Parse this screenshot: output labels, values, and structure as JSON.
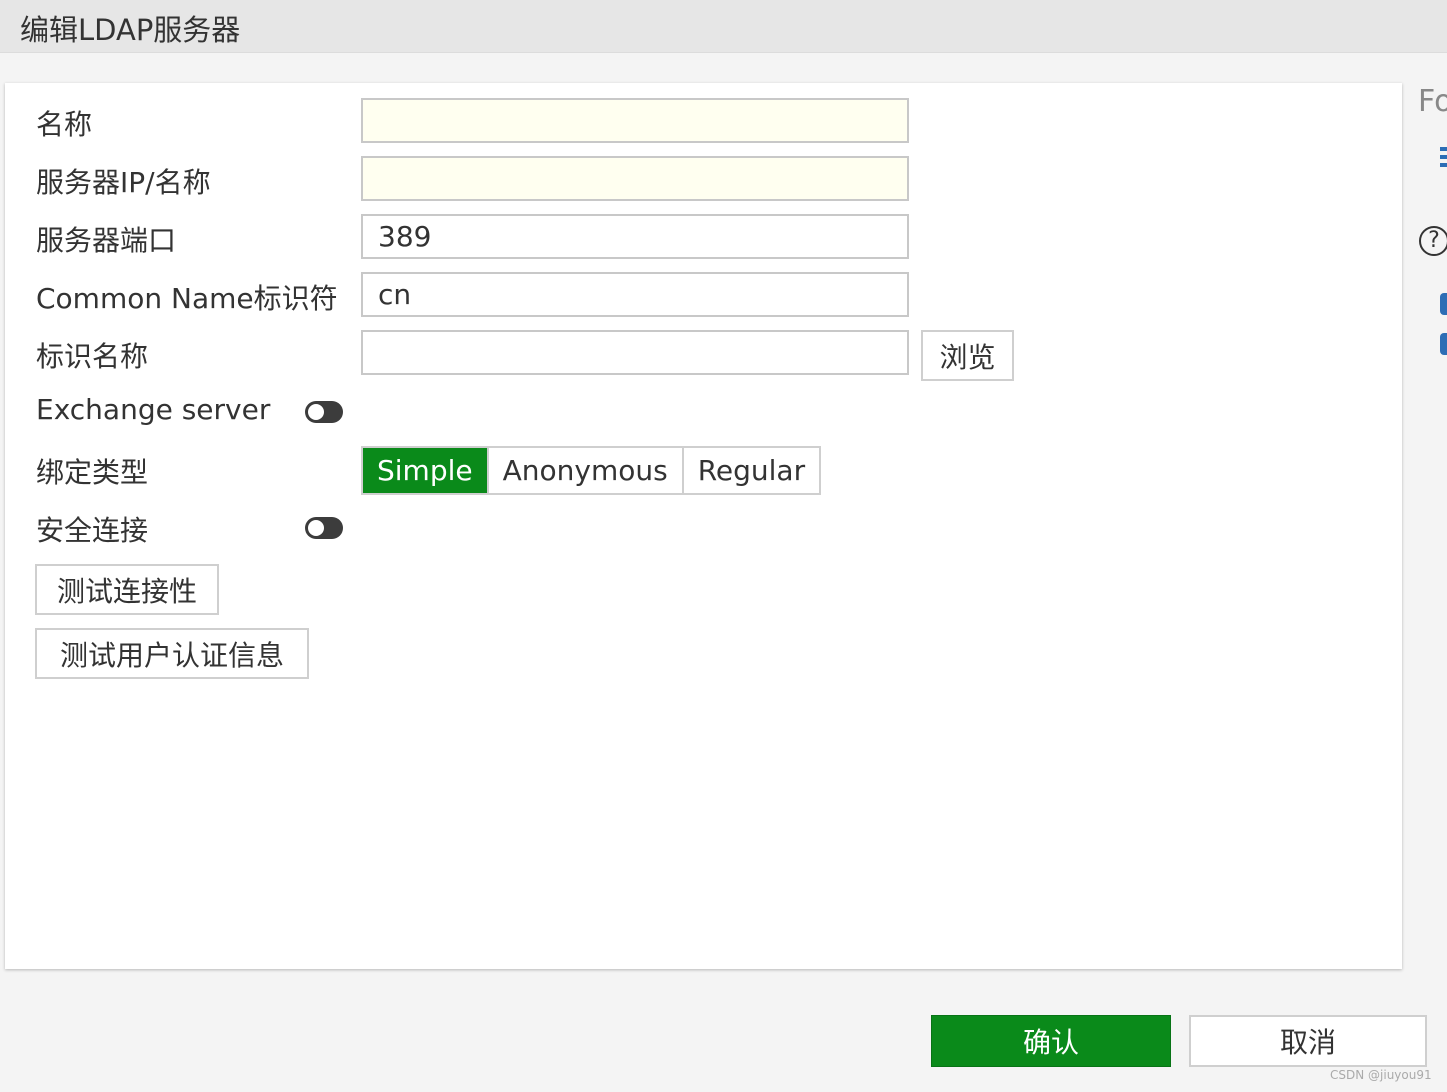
{
  "window": {
    "title": "编辑LDAP服务器"
  },
  "form": {
    "name": {
      "label": "名称",
      "value": ""
    },
    "server_ip": {
      "label": "服务器IP/名称",
      "value": ""
    },
    "server_port": {
      "label": "服务器端口",
      "value": "389"
    },
    "common_name": {
      "label": "Common Name标识符",
      "value": "cn"
    },
    "dn": {
      "label": "标识名称",
      "value": "",
      "browse_label": "浏览"
    },
    "exchange": {
      "label": "Exchange server",
      "enabled": false
    },
    "bind_type": {
      "label": "绑定类型",
      "options": [
        "Simple",
        "Anonymous",
        "Regular"
      ],
      "selected": "Simple"
    },
    "secure": {
      "label": "安全连接",
      "enabled": false
    },
    "test_connectivity_label": "测试连接性",
    "test_user_label": "测试用户认证信息"
  },
  "footer": {
    "ok_label": "确认",
    "cancel_label": "取消"
  },
  "side": {
    "text": "Fo",
    "help": "?"
  },
  "watermark": "CSDN @jiuyou91",
  "colors": {
    "accent": "#0a8a1a",
    "required_bg": "#fffff0"
  }
}
